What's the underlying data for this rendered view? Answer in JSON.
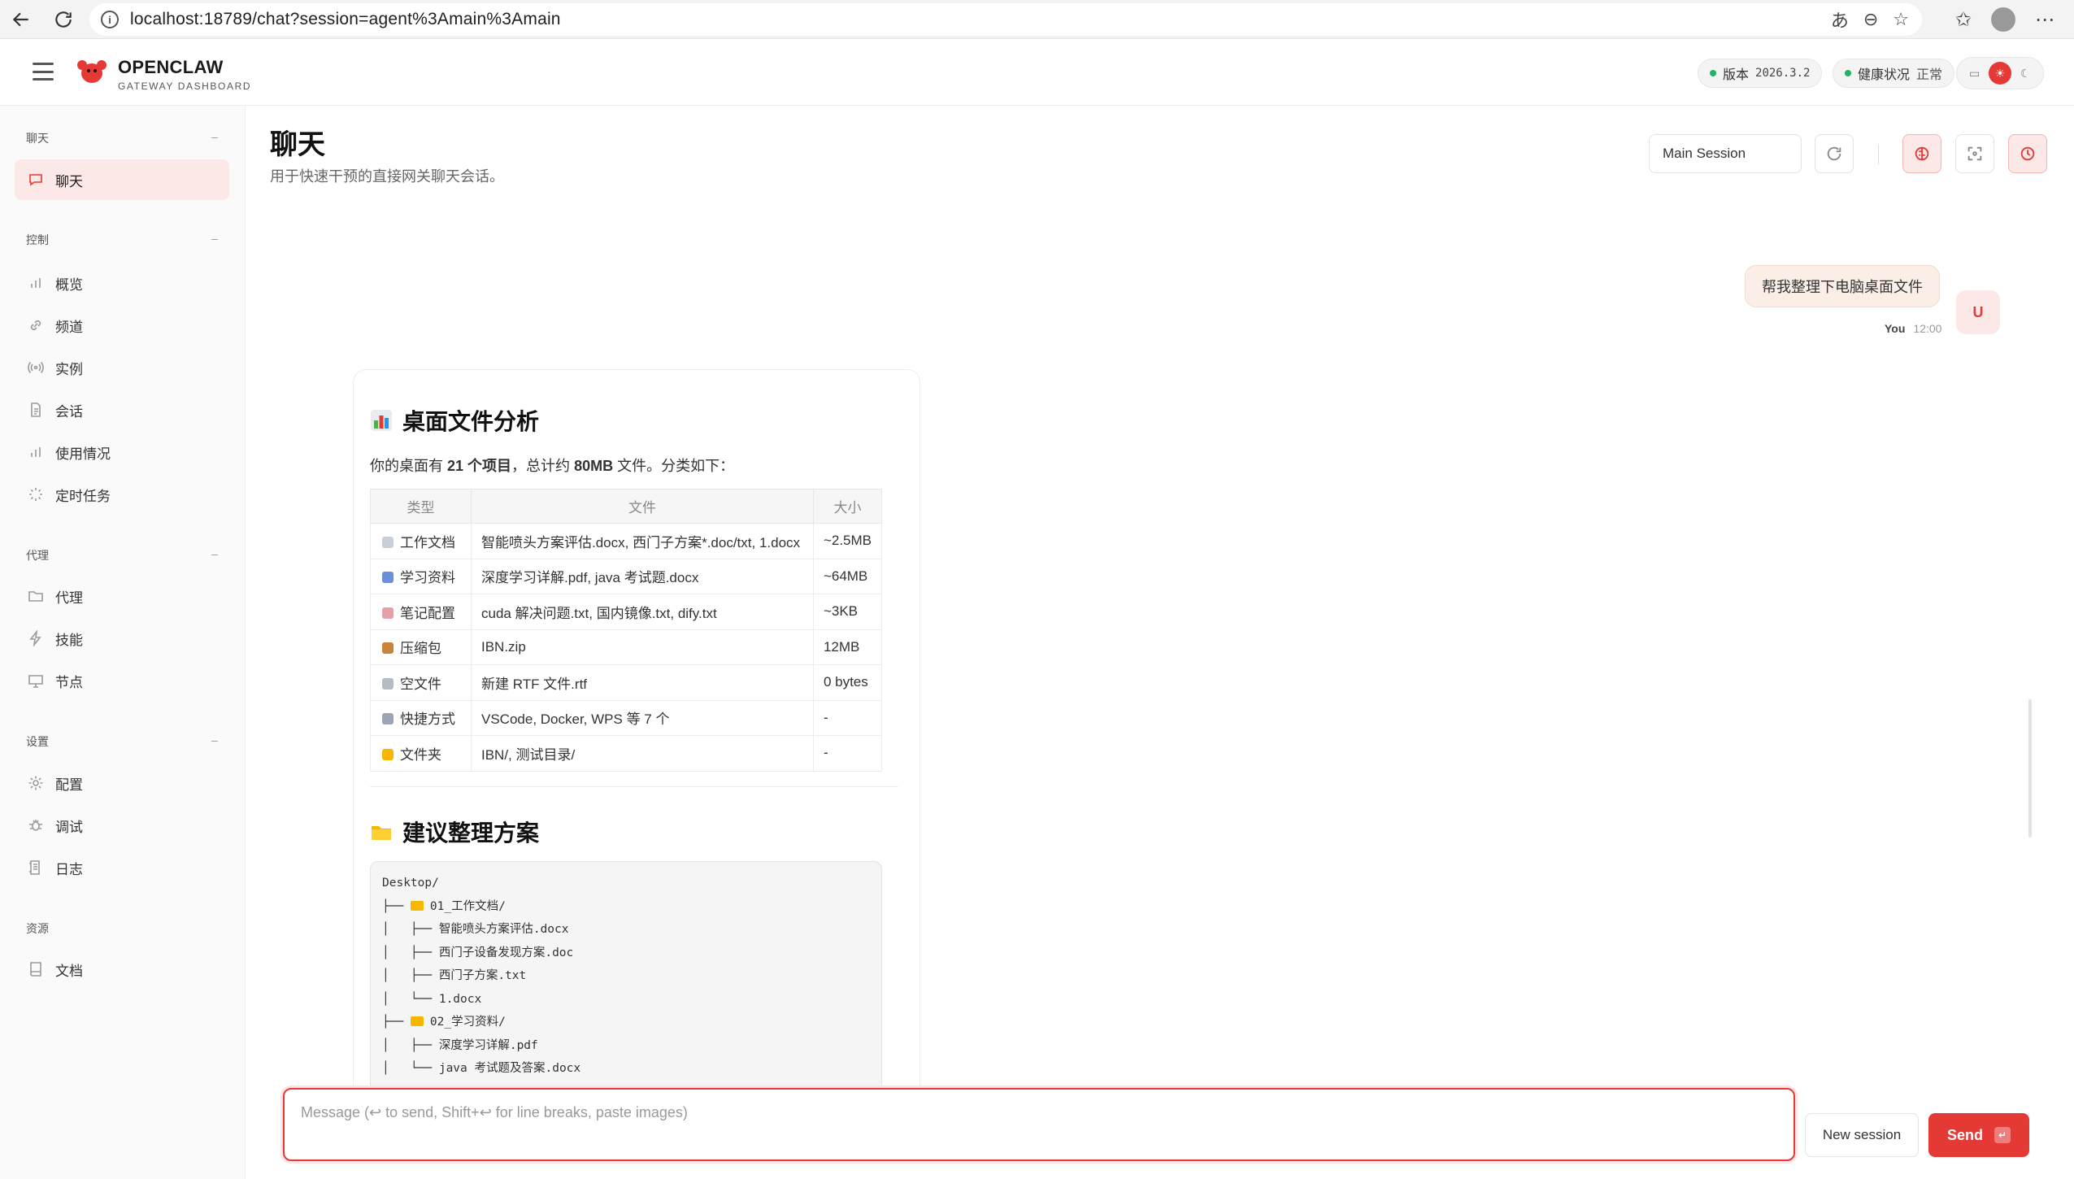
{
  "browser": {
    "url": "localhost:18789/chat?session=agent%3Amain%3Amain"
  },
  "header": {
    "brand_name": "OPENCLAW",
    "brand_sub": "GATEWAY DASHBOARD",
    "version_label": "版本",
    "version_value": "2026.3.2",
    "health_label": "健康状况",
    "health_value": "正常",
    "status_color": "#1fb364",
    "accent_color": "#e53935"
  },
  "sidebar": {
    "sections": [
      {
        "title": "聊天",
        "dash": "–"
      },
      {
        "title": "控制",
        "dash": "–"
      },
      {
        "title": "代理",
        "dash": "–"
      },
      {
        "title": "设置",
        "dash": "–"
      },
      {
        "title": "资源",
        "dash": ""
      }
    ],
    "items": [
      {
        "label": "聊天",
        "icon": "chat-icon"
      },
      {
        "label": "概览",
        "icon": "bar-chart-icon"
      },
      {
        "label": "频道",
        "icon": "link-icon"
      },
      {
        "label": "实例",
        "icon": "broadcast-icon"
      },
      {
        "label": "会话",
        "icon": "document-icon"
      },
      {
        "label": "使用情况",
        "icon": "bar-chart-icon"
      },
      {
        "label": "定时任务",
        "icon": "loader-icon"
      },
      {
        "label": "代理",
        "icon": "folder-icon"
      },
      {
        "label": "技能",
        "icon": "lightning-icon"
      },
      {
        "label": "节点",
        "icon": "monitor-icon"
      },
      {
        "label": "配置",
        "icon": "gear-icon"
      },
      {
        "label": "调试",
        "icon": "bug-icon"
      },
      {
        "label": "日志",
        "icon": "log-icon"
      },
      {
        "label": "文档",
        "icon": "book-icon"
      }
    ]
  },
  "main": {
    "title": "聊天",
    "subtitle": "用于快速干预的直接网关聊天会话。",
    "session_select": "Main Session"
  },
  "chat": {
    "user_message": "帮我整理下电脑桌面文件",
    "user_avatar": "U",
    "user_name": "You",
    "user_time": "12:00",
    "analysis_title": "桌面文件分析",
    "intro_pre": "你的桌面有 ",
    "intro_count": "21 个项目",
    "intro_mid": "，总计约 ",
    "intro_size": "80MB",
    "intro_post": " 文件。分类如下：",
    "table_headers": [
      "类型",
      "文件",
      "大小"
    ],
    "table_rows": [
      {
        "type": "工作文档",
        "files": "智能喷头方案评估.docx, 西门子方案*.doc/txt, 1.docx",
        "size": "~2.5MB",
        "icon_color": "#c9cfd8"
      },
      {
        "type": "学习资料",
        "files": "深度学习详解.pdf, java 考试题.docx",
        "size": "~64MB",
        "icon_color": "#6b8fd8"
      },
      {
        "type": "笔记配置",
        "files": "cuda 解决问题.txt, 国内镜像.txt, dify.txt",
        "size": "~3KB",
        "icon_color": "#e8a0a8"
      },
      {
        "type": "压缩包",
        "files": "IBN.zip",
        "size": "12MB",
        "icon_color": "#c8843a"
      },
      {
        "type": "空文件",
        "files": "新建 RTF 文件.rtf",
        "size": "0 bytes",
        "icon_color": "#b5bcc6"
      },
      {
        "type": "快捷方式",
        "files": "VSCode, Docker, WPS 等 7 个",
        "size": "-",
        "icon_color": "#9aa6b5"
      },
      {
        "type": "文件夹",
        "files": "IBN/, 测试目录/",
        "size": "-",
        "icon_color": "#f5b700"
      }
    ],
    "plan_title": "建议整理方案",
    "code_lines": [
      {
        "text": "Desktop/",
        "folder": false
      },
      {
        "prefix": "├── ",
        "text": "01_工作文档/",
        "folder": true
      },
      {
        "text": "│   ├── 智能喷头方案评估.docx",
        "folder": false
      },
      {
        "text": "│   ├── 西门子设备发现方案.doc",
        "folder": false
      },
      {
        "text": "│   ├── 西门子方案.txt",
        "folder": false
      },
      {
        "text": "│   └── 1.docx",
        "folder": false
      },
      {
        "prefix": "├── ",
        "text": "02_学习资料/",
        "folder": true
      },
      {
        "text": "│   ├── 深度学习详解.pdf",
        "folder": false
      },
      {
        "text": "│   └── java 考试题及答案.docx",
        "folder": false
      }
    ]
  },
  "composer": {
    "placeholder": "Message (↩ to send, Shift+↩ for line breaks, paste images)",
    "new_session": "New session",
    "send": "Send",
    "send_key": "↵"
  }
}
